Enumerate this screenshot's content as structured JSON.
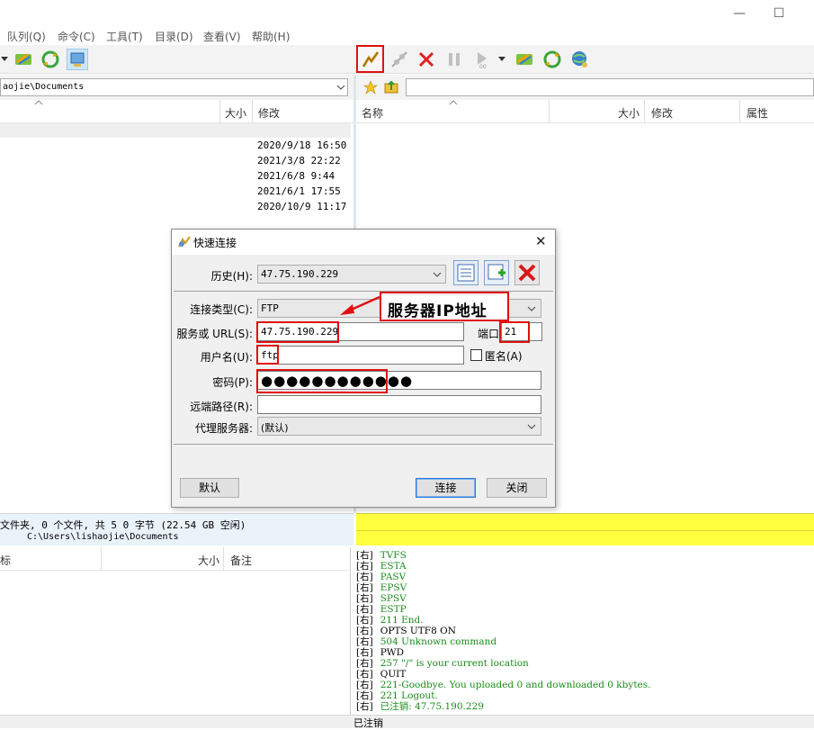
{
  "window": {
    "minimize": "—",
    "maximize": "☐"
  },
  "menu": [
    "队列(Q)",
    "命令(C)",
    "工具(T)",
    "目录(D)",
    "查看(V)",
    "帮助(H)"
  ],
  "left": {
    "path": "aojie\\Documents",
    "columns": {
      "size": "大小",
      "modified": "修改"
    },
    "dates": [
      "2020/9/18 16:50",
      "2021/3/8 22:22",
      "2021/6/8 9:44",
      "2021/6/1 17:55",
      "2020/10/9 11:17"
    ],
    "status_line1": "文件夹, 0 个文件, 共 5 0 字节 (22.54 GB 空闲)",
    "status_line2": "C:\\Users\\lishaojie\\Documents"
  },
  "right": {
    "path": "",
    "columns": {
      "name": "名称",
      "size": "大小",
      "modified": "修改",
      "attr": "属性"
    }
  },
  "queue": {
    "col1": "标",
    "col2": "大小",
    "col3": "备注"
  },
  "log": [
    {
      "tag": "右",
      "text": "TVFS",
      "color": "#1a8c1a"
    },
    {
      "tag": "右",
      "text": "ESTA",
      "color": "#1a8c1a"
    },
    {
      "tag": "右",
      "text": "PASV",
      "color": "#1a8c1a"
    },
    {
      "tag": "右",
      "text": "EPSV",
      "color": "#1a8c1a"
    },
    {
      "tag": "右",
      "text": "SPSV",
      "color": "#1a8c1a"
    },
    {
      "tag": "右",
      "text": "ESTP",
      "color": "#1a8c1a"
    },
    {
      "tag": "右",
      "text": "211 End.",
      "color": "#1a8c1a"
    },
    {
      "tag": "右",
      "text": "OPTS UTF8 ON",
      "color": "#000000"
    },
    {
      "tag": "右",
      "text": "504 Unknown command",
      "color": "#1a8c1a"
    },
    {
      "tag": "右",
      "text": "PWD",
      "color": "#000000"
    },
    {
      "tag": "右",
      "text": "257 \"/\" is your current location",
      "color": "#1a8c1a"
    },
    {
      "tag": "右",
      "text": "QUIT",
      "color": "#000000"
    },
    {
      "tag": "右",
      "text": "221-Goodbye. You uploaded 0 and downloaded 0 kbytes.",
      "color": "#1a8c1a"
    },
    {
      "tag": "右",
      "text": "221 Logout.",
      "color": "#1a8c1a"
    },
    {
      "tag": "右",
      "text": "已注销: 47.75.190.229",
      "color": "#1a8c1a"
    }
  ],
  "statusbar": {
    "text": "已注销"
  },
  "dialog": {
    "title": "快速连接",
    "close": "✕",
    "history_label": "历史(H):",
    "history_value": "47.75.190.229",
    "conn_type_label": "连接类型(C):",
    "conn_type_value": "FTP",
    "server_label": "服务或 URL(S):",
    "server_value": "47.75.190.229",
    "port_label": "端口:",
    "port_value": "21",
    "user_label": "用户名(U):",
    "user_value": "ftp",
    "anon_label": "匿名(A)",
    "password_label": "密码(P):",
    "password_value": "●●●●●●●●●●●●",
    "remote_label": "远端路径(R):",
    "remote_value": "",
    "proxy_label": "代理服务器:",
    "proxy_value": "(默认)",
    "default_btn": "默认",
    "connect_btn": "连接",
    "close_btn": "关闭"
  },
  "annotation": {
    "text": "服务器IP地址"
  },
  "colors": {
    "accent_red": "#e01010",
    "yellow_status": "#ffff40",
    "log_green": "#1a8c1a"
  }
}
